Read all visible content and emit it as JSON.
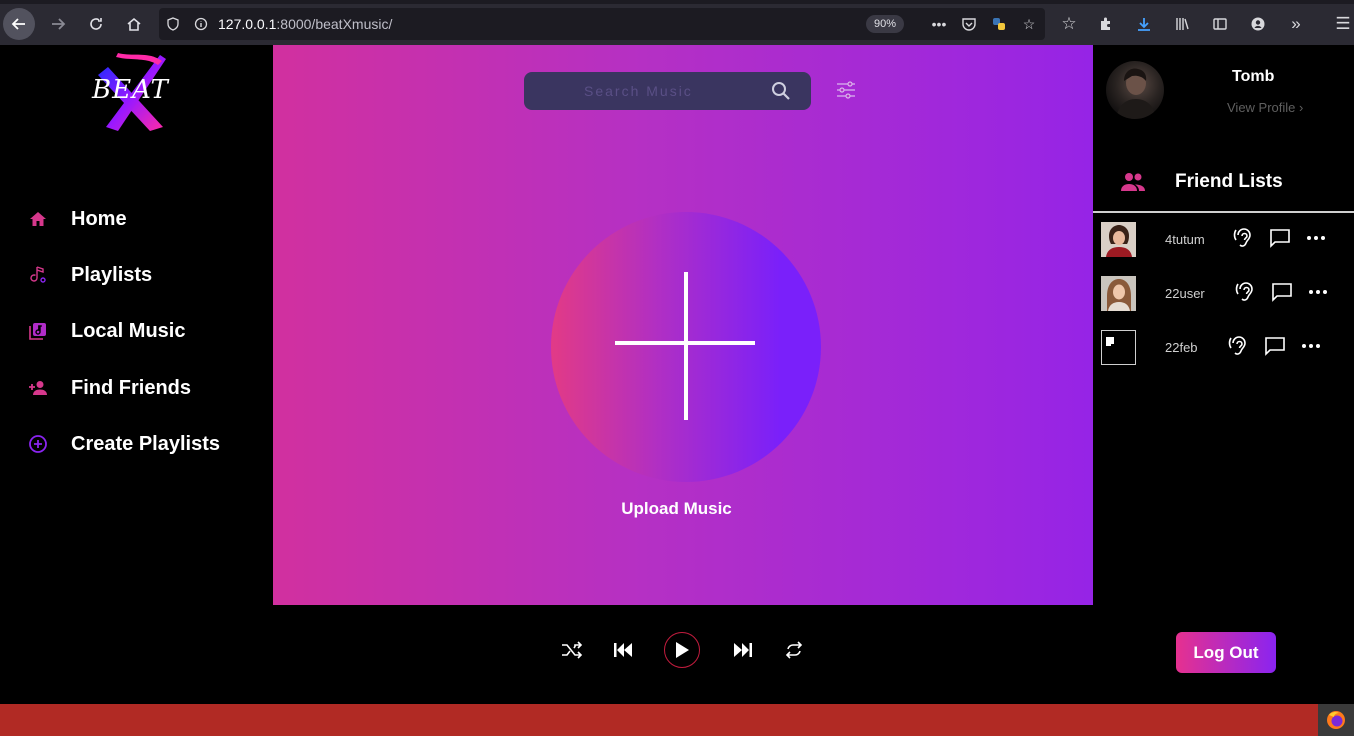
{
  "browser": {
    "url_host": "127.0.0.1",
    "url_path": ":8000/beatXmusic/",
    "zoom": "90%"
  },
  "app": {
    "logo_text": "BEAT"
  },
  "nav": {
    "items": [
      {
        "label": "Home",
        "icon": "home-icon",
        "color": "#d6388c"
      },
      {
        "label": "Playlists",
        "icon": "playlist-music-icon",
        "color": "#d6388c"
      },
      {
        "label": "Local Music",
        "icon": "library-music-icon",
        "color": "#d6388c"
      },
      {
        "label": "Find Friends",
        "icon": "person-add-icon",
        "color": "#d6388c"
      },
      {
        "label": "Create Playlists",
        "icon": "add-circle-icon",
        "color": "#8a24f0"
      }
    ]
  },
  "main": {
    "search_placeholder": "Search Music",
    "upload_label": "Upload Music"
  },
  "profile": {
    "username": "Tomb",
    "view_profile": "View Profile ›"
  },
  "friends": {
    "title": "Friend Lists",
    "list": [
      {
        "name": "4tutum"
      },
      {
        "name": "22user"
      },
      {
        "name": "22feb"
      }
    ]
  },
  "player": {
    "logout_label": "Log Out"
  },
  "colors": {
    "accent_pink": "#e6318f",
    "accent_purple": "#8a24f0",
    "bottom_bar": "#b12a24"
  }
}
